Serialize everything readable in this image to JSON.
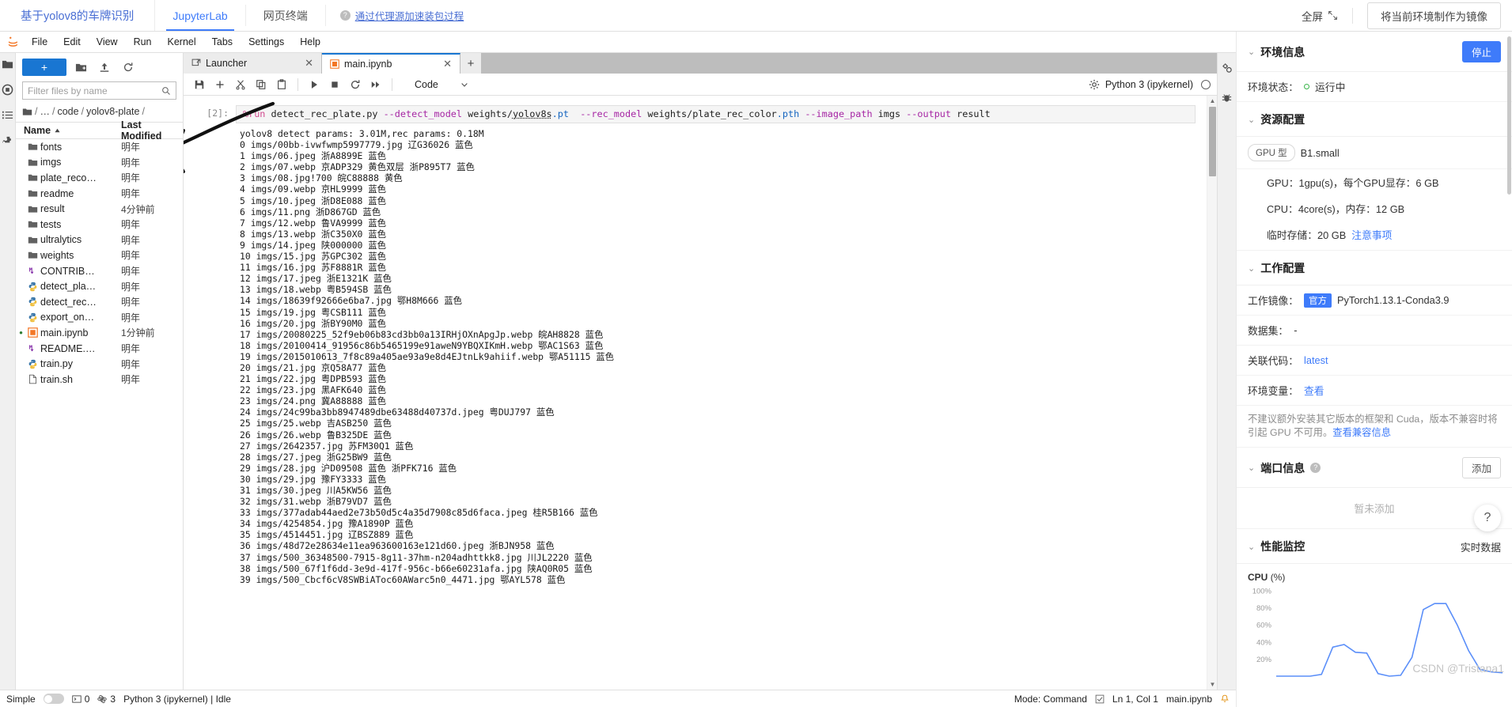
{
  "topbar": {
    "brand": "基于yolov8的车牌识别",
    "tabs": [
      {
        "label": "JupyterLab",
        "active": true
      },
      {
        "label": "网页终端",
        "active": false
      }
    ],
    "proxy_link": "通过代理源加速装包过程",
    "proxy_icon": "question-circle-icon",
    "fullscreen": "全屏",
    "fullscreen_icon": "expand-icon",
    "make_image_button": "将当前环境制作为镜像"
  },
  "jupyter": {
    "menu": [
      "File",
      "Edit",
      "View",
      "Run",
      "Kernel",
      "Tabs",
      "Settings",
      "Help"
    ],
    "left_rail_icons": [
      "folder-icon",
      "running-icon",
      "commands-icon",
      "extensions-icon"
    ],
    "right_rail_icons": [
      "property-inspector-icon",
      "debugger-icon"
    ],
    "filebrowser": {
      "new_button": "+",
      "toolbar_icons": [
        "new-folder-icon",
        "upload-icon",
        "refresh-icon"
      ],
      "filter_placeholder": "Filter files by name",
      "filter_value": "",
      "search_icon": "search-icon",
      "breadcrumb": [
        "/",
        "…",
        "code",
        "yolov8-plate",
        "/"
      ],
      "columns": {
        "name": "Name",
        "modified": "Last Modified"
      },
      "sort_icon": "sort-asc-icon",
      "items": [
        {
          "name": "fonts",
          "modified": "明年",
          "kind": "folder",
          "dot": false
        },
        {
          "name": "imgs",
          "modified": "明年",
          "kind": "folder",
          "dot": false
        },
        {
          "name": "plate_reco…",
          "modified": "明年",
          "kind": "folder",
          "dot": false
        },
        {
          "name": "readme",
          "modified": "明年",
          "kind": "folder",
          "dot": false
        },
        {
          "name": "result",
          "modified": "4分钟前",
          "kind": "folder",
          "dot": false
        },
        {
          "name": "tests",
          "modified": "明年",
          "kind": "folder",
          "dot": false
        },
        {
          "name": "ultralytics",
          "modified": "明年",
          "kind": "folder",
          "dot": false
        },
        {
          "name": "weights",
          "modified": "明年",
          "kind": "folder",
          "dot": false
        },
        {
          "name": "CONTRIB…",
          "modified": "明年",
          "kind": "markdown",
          "dot": false
        },
        {
          "name": "detect_pla…",
          "modified": "明年",
          "kind": "python",
          "dot": false
        },
        {
          "name": "detect_rec…",
          "modified": "明年",
          "kind": "python",
          "dot": false
        },
        {
          "name": "export_on…",
          "modified": "明年",
          "kind": "python",
          "dot": false
        },
        {
          "name": "main.ipynb",
          "modified": "1分钟前",
          "kind": "notebook",
          "dot": true
        },
        {
          "name": "README.…",
          "modified": "明年",
          "kind": "markdown",
          "dot": false
        },
        {
          "name": "train.py",
          "modified": "明年",
          "kind": "python",
          "dot": false
        },
        {
          "name": "train.sh",
          "modified": "明年",
          "kind": "file",
          "dot": false
        }
      ]
    },
    "tabs": [
      {
        "label": "Launcher",
        "icon": "launcher-icon",
        "active": false
      },
      {
        "label": "main.ipynb",
        "icon": "notebook-icon",
        "active": true
      }
    ],
    "tab_add": "+",
    "toolbar_icons": [
      "save-icon",
      "insert-cell-icon",
      "cut-icon",
      "copy-icon",
      "paste-icon",
      "run-icon",
      "stop-icon",
      "restart-icon",
      "restart-run-all-icon"
    ],
    "celltype": {
      "value": "Code",
      "chevron": "chevron-down-icon"
    },
    "settings_icon": "gear-icon",
    "kernel_name": "Python 3 (ipykernel)",
    "kernel_status_icon": "kernel-idle-circle-icon",
    "cell": {
      "prompt": "[2]:",
      "code_parts": [
        {
          "t": "%run",
          "c": "magic"
        },
        {
          "t": " detect_rec_plate.py ",
          "c": "plain"
        },
        {
          "t": "--detect_model",
          "c": "op"
        },
        {
          "t": " weights/",
          "c": "plain"
        },
        {
          "t": "yolov8s",
          "c": "underline"
        },
        {
          "t": ".pt",
          "c": "str"
        },
        {
          "t": "  ",
          "c": "plain"
        },
        {
          "t": "--rec_model",
          "c": "op"
        },
        {
          "t": " weights/plate_rec_color",
          "c": "plain"
        },
        {
          "t": ".pth",
          "c": "str"
        },
        {
          "t": " ",
          "c": "plain"
        },
        {
          "t": "--image_path",
          "c": "op"
        },
        {
          "t": " imgs ",
          "c": "plain"
        },
        {
          "t": "--output",
          "c": "op"
        },
        {
          "t": " result",
          "c": "plain"
        }
      ],
      "output_lines": [
        "yolov8 detect params: 3.01M,rec params: 0.18M",
        "0 imgs/00bb-ivwfwmp5997779.jpg 辽G36026 蓝色",
        "1 imgs/06.jpeg 浙A8899E 蓝色",
        "2 imgs/07.webp 京ADP329 黄色双层 浙P895T7 蓝色",
        "3 imgs/08.jpg!700 皖C88888 黄色",
        "4 imgs/09.webp 京HL9999 蓝色",
        "5 imgs/10.jpeg 浙D8E088 蓝色",
        "6 imgs/11.png 浙D867GD 蓝色",
        "7 imgs/12.webp 鲁VA9999 蓝色",
        "8 imgs/13.webp 浙C350X0 蓝色",
        "9 imgs/14.jpeg 陕000000 蓝色",
        "10 imgs/15.jpg 苏GPC302 蓝色",
        "11 imgs/16.jpg 苏F8881R 蓝色",
        "12 imgs/17.jpeg 浙E1321K 蓝色",
        "13 imgs/18.webp 粤B594SB 蓝色",
        "14 imgs/18639f92666e6ba7.jpg 鄂H8M666 蓝色",
        "15 imgs/19.jpg 粤CSB111 蓝色",
        "16 imgs/20.jpg 浙BY90M0 蓝色",
        "17 imgs/20080225_52f9eb06b83cd3bb0a13IRHjOXnApgJp.webp 皖AH8828 蓝色",
        "18 imgs/20100414_91956c86b5465199e91aweN9YBQXIKmH.webp 鄂AC1S63 蓝色",
        "19 imgs/2015010613_7f8c89a405ae93a9e8d4EJtnLk9ahiif.webp 鄂A51115 蓝色",
        "20 imgs/21.jpg 京Q58A77 蓝色",
        "21 imgs/22.jpg 粤DPB593 蓝色",
        "22 imgs/23.jpg 黑AFK640 蓝色",
        "23 imgs/24.png 冀A88888 蓝色",
        "24 imgs/24c99ba3bb8947489dbe63488d40737d.jpeg 粤DUJ797 蓝色",
        "25 imgs/25.webp 吉ASB250 蓝色",
        "26 imgs/26.webp 鲁B325DE 蓝色",
        "27 imgs/2642357.jpg 苏FM30Q1 蓝色",
        "28 imgs/27.jpeg 浙G25BW9 蓝色",
        "29 imgs/28.jpg 沪D09508 蓝色 浙PFK716 蓝色",
        "30 imgs/29.jpg 豫FY3333 蓝色",
        "31 imgs/30.jpeg 川A5KW56 蓝色",
        "32 imgs/31.webp 浙B79VD7 蓝色",
        "33 imgs/377adab44aed2e73b50d5c4a35d7908c85d6faca.jpeg 桂R5B166 蓝色",
        "34 imgs/4254854.jpg 豫A1890P 蓝色",
        "35 imgs/4514451.jpg 辽BSZ889 蓝色",
        "36 imgs/48d72e28634e11ea963600163e121d60.jpeg 浙BJN958 蓝色",
        "37 imgs/500_36348500-7915-8g11-37hm-n204adhttkk8.jpg 川JL2220 蓝色",
        "38 imgs/500_67f1f6dd-3e9d-417f-956c-b66e60231afa.jpg 陕AQ0R05 蓝色",
        "39 imgs/500_Cbcf6cV8SWBiAToc60AWarc5n0_4471.jpg 鄂AYL578 蓝色"
      ]
    },
    "statusbar": {
      "simple_label": "Simple",
      "counts": [
        "0",
        "3"
      ],
      "terminal_icon": "terminal-icon",
      "kernel_icon": "kernel-icon",
      "kernel_text": "Python 3 (ipykernel) | Idle",
      "mode": "Mode: Command",
      "check_icon": "check-icon",
      "position": "Ln 1, Col 1",
      "filename": "main.ipynb",
      "bell_icon": "bell-icon"
    }
  },
  "env_panel": {
    "sections": {
      "env_info": {
        "title": "环境信息",
        "stop_button": "停止",
        "status_label": "环境状态：",
        "status_value": "运行中"
      },
      "resource": {
        "title": "资源配置",
        "gpu_chip": "GPU 型",
        "spec_name": "B1.small",
        "gpu_line": "GPU：1gpu(s)，每个GPU显存：6 GB",
        "cpu_line": "CPU：4core(s)，内存：12 GB",
        "storage_label": "临时存储：20 GB",
        "storage_link": "注意事项"
      },
      "work_config": {
        "title": "工作配置",
        "image_label": "工作镜像：",
        "image_badge": "官方",
        "image_value": "PyTorch1.13.1-Conda3.9",
        "dataset_label": "数据集：",
        "dataset_value": "-",
        "code_label": "关联代码：",
        "code_value": "latest",
        "envvar_label": "环境变量：",
        "envvar_value": "查看",
        "note_text": "不建议额外安装其它版本的框架和 Cuda，版本不兼容时将引起 GPU 不可用。",
        "note_link": "查看兼容信息"
      },
      "port_info": {
        "title": "端口信息",
        "help_icon": "question-circle-icon",
        "add_button": "添加",
        "empty_text": "暂未添加"
      },
      "perf": {
        "title": "性能监控",
        "realtime": "实时数据"
      }
    },
    "watermark": "CSDN @Tristana1",
    "help_fab": "?"
  },
  "chart_data": {
    "type": "line",
    "title": "CPU",
    "unit": "(%)",
    "ylabel": "",
    "xlabel": "",
    "ylim": [
      0,
      100
    ],
    "yticks": [
      100,
      80,
      60,
      40,
      20
    ],
    "ytick_labels": [
      "100%",
      "80%",
      "60%",
      "40%",
      "20%"
    ],
    "grid": false,
    "legend": "none",
    "series": [
      {
        "name": "CPU",
        "color": "#5b8ff9",
        "x": [
          0,
          1,
          2,
          3,
          4,
          5,
          6,
          7,
          8,
          9,
          10,
          11,
          12,
          13,
          14,
          15,
          16,
          17,
          18,
          19,
          20
        ],
        "values": [
          0,
          0,
          0,
          0,
          2,
          34,
          37,
          28,
          27,
          3,
          0,
          1,
          22,
          78,
          85,
          85,
          60,
          30,
          8,
          5,
          4
        ]
      }
    ]
  }
}
